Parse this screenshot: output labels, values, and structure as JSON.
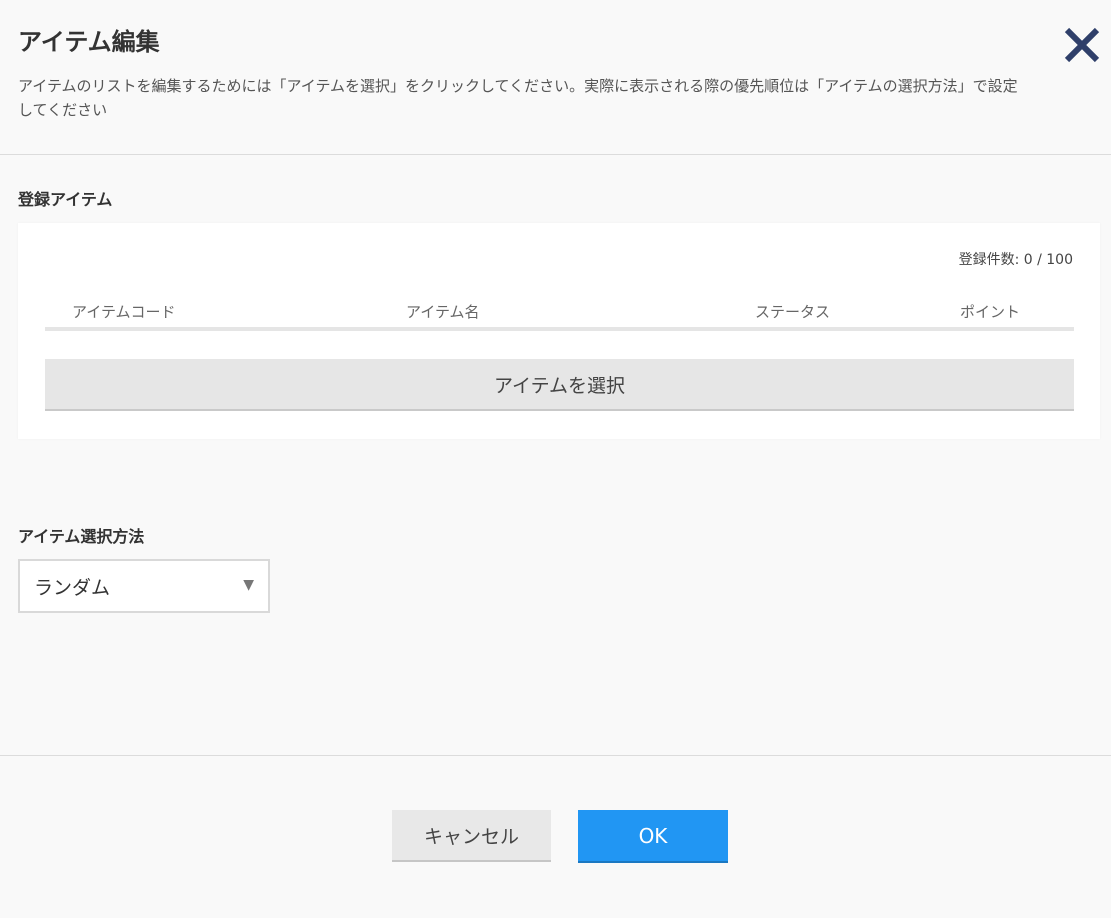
{
  "dialog": {
    "title": "アイテム編集",
    "description": "アイテムのリストを編集するためには「アイテムを選択」をクリックしてください。実際に表示される際の優先順位は「アイテムの選択方法」で設定してください",
    "close_icon": "close-icon"
  },
  "registered": {
    "label": "登録アイテム",
    "count_text": "登録件数: 0 / 100",
    "columns": [
      "アイテムコード",
      "アイテム名",
      "ステータス",
      "ポイント"
    ],
    "rows": [],
    "select_button_label": "アイテムを選択"
  },
  "selection_method": {
    "label": "アイテム選択方法",
    "value": "ランダム",
    "arrow_icon": "triangle-down-icon"
  },
  "footer": {
    "cancel_label": "キャンセル",
    "ok_label": "OK"
  },
  "colors": {
    "accent": "#2196f3",
    "close_icon": "#2f3f6a",
    "background": "#f9f9f9"
  }
}
